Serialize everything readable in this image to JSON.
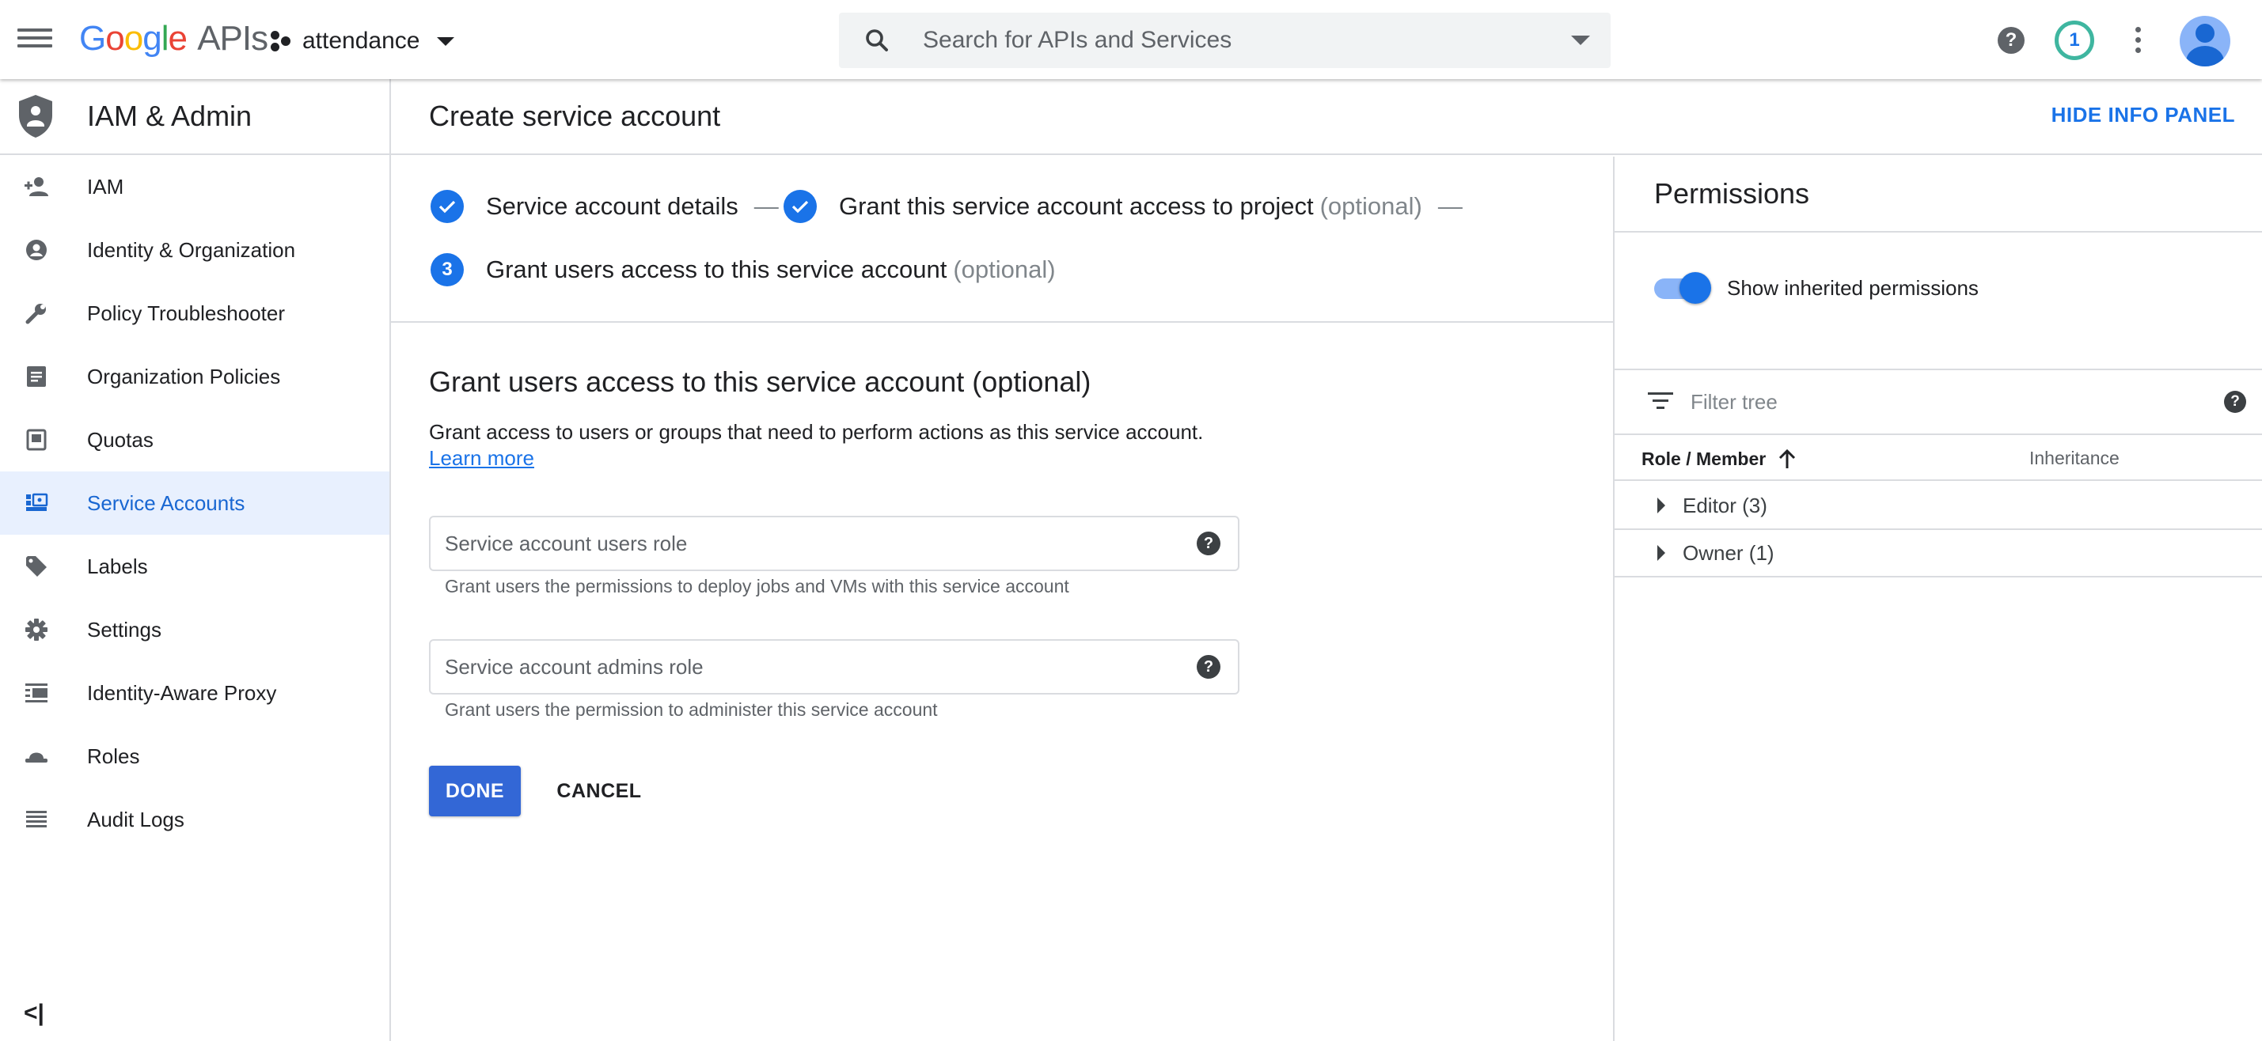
{
  "topbar": {
    "logo_letters": [
      "G",
      "o",
      "o",
      "g",
      "l",
      "e"
    ],
    "logo_colors": [
      "#4285F4",
      "#EA4335",
      "#FBBC05",
      "#4285F4",
      "#34A853",
      "#EA4335"
    ],
    "logo_suffix": "APIs",
    "project_name": "attendance",
    "search_placeholder": "Search for APIs and Services",
    "help_glyph": "?",
    "notification_count": "1"
  },
  "sidebar": {
    "title": "IAM & Admin",
    "items": [
      {
        "label": "IAM",
        "icon": "person-add-icon",
        "active": false
      },
      {
        "label": "Identity & Organization",
        "icon": "account-circle-icon",
        "active": false
      },
      {
        "label": "Policy Troubleshooter",
        "icon": "wrench-icon",
        "active": false
      },
      {
        "label": "Organization Policies",
        "icon": "document-icon",
        "active": false
      },
      {
        "label": "Quotas",
        "icon": "quota-icon",
        "active": false
      },
      {
        "label": "Service Accounts",
        "icon": "service-account-icon",
        "active": true
      },
      {
        "label": "Labels",
        "icon": "label-tag-icon",
        "active": false
      },
      {
        "label": "Settings",
        "icon": "gear-icon",
        "active": false
      },
      {
        "label": "Identity-Aware Proxy",
        "icon": "proxy-icon",
        "active": false
      },
      {
        "label": "Roles",
        "icon": "hat-icon",
        "active": false
      },
      {
        "label": "Audit Logs",
        "icon": "list-icon",
        "active": false
      }
    ],
    "collapse_glyph": "<|"
  },
  "header": {
    "title": "Create service account",
    "hide_panel": "HIDE INFO PANEL"
  },
  "stepper": {
    "step1": "Service account details",
    "step2": "Grant this service account access to project",
    "step2_optional": "(optional)",
    "step3_number": "3",
    "step3": "Grant users access to this service account",
    "step3_optional": "(optional)",
    "separator": "—"
  },
  "form": {
    "heading": "Grant users access to this service account (optional)",
    "description": "Grant access to users or groups that need to perform actions as this service account.",
    "learn_more": "Learn more",
    "users_role_placeholder": "Service account users role",
    "users_role_hint": "Grant users the permissions to deploy jobs and VMs with this service account",
    "admins_role_placeholder": "Service account admins role",
    "admins_role_hint": "Grant users the permission to administer this service account",
    "help_glyph": "?",
    "done": "DONE",
    "cancel": "CANCEL"
  },
  "panel": {
    "title": "Permissions",
    "toggle_label": "Show inherited permissions",
    "toggle_on": true,
    "filter_placeholder": "Filter tree",
    "help_glyph": "?",
    "col_role": "Role / Member",
    "col_inheritance": "Inheritance",
    "rows": [
      "Editor (3)",
      "Owner (1)"
    ]
  }
}
